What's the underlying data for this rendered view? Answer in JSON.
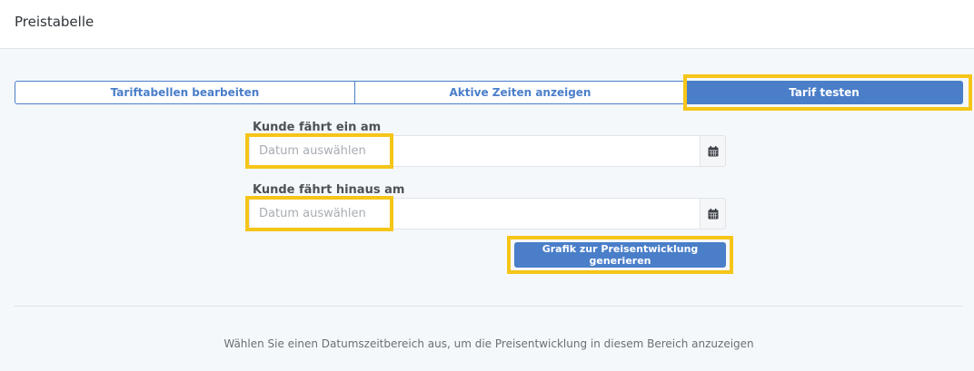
{
  "header": {
    "title": "Preistabelle"
  },
  "tabs": [
    {
      "label": "Tariftabellen bearbeiten",
      "active": false
    },
    {
      "label": "Aktive Zeiten anzeigen",
      "active": false
    },
    {
      "label": "Tarif testen",
      "active": true
    }
  ],
  "form": {
    "checkin": {
      "label": "Kunde fährt ein am",
      "placeholder": "Datum auswählen",
      "value": ""
    },
    "checkout": {
      "label": "Kunde fährt hinaus am",
      "placeholder": "Datum auswählen",
      "value": ""
    },
    "generate_button": "Grafik zur Preisentwicklung generieren"
  },
  "info_text": "Wählen Sie einen Datumszeitbereich aus, um die Preisentwicklung in diesem Bereich anzuzeigen",
  "icons": {
    "calendar": "calendar-icon"
  },
  "colors": {
    "accent": "#4a7ec9",
    "highlight": "#f5c518",
    "background": "#f5f8fb"
  }
}
